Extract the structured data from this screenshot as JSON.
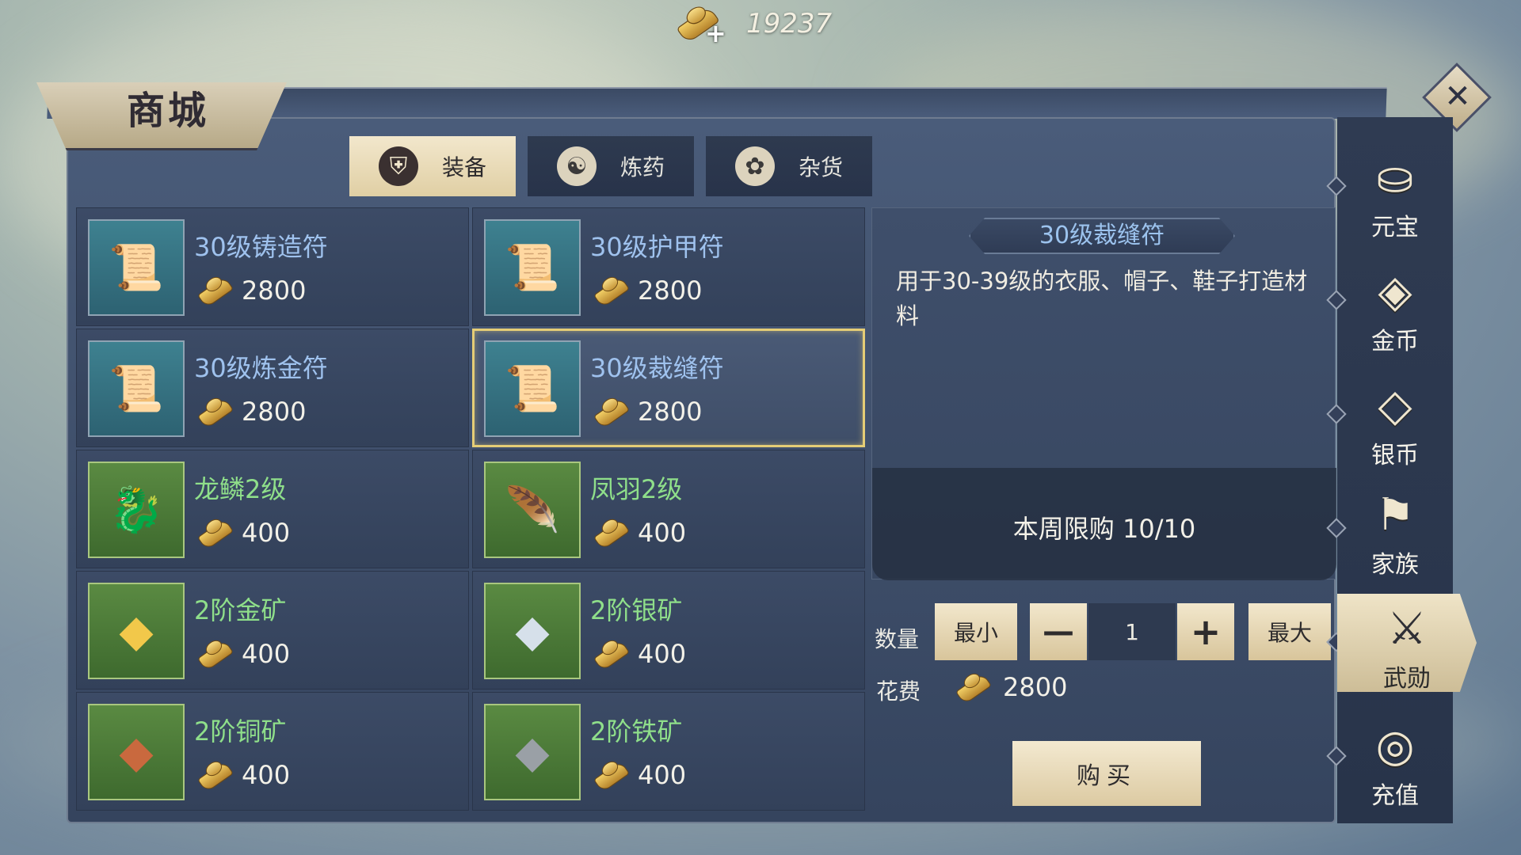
{
  "currency": {
    "amount": "19237",
    "icon": "gold-ingot-plus-icon"
  },
  "title": "商城",
  "tabs": [
    {
      "label": "装备",
      "icon": "armor-icon",
      "active": true
    },
    {
      "label": "炼药",
      "icon": "alchemy-icon",
      "active": false
    },
    {
      "label": "杂货",
      "icon": "goods-bag-icon",
      "active": false
    }
  ],
  "items": [
    {
      "name": "30级铸造符",
      "price": "2800",
      "icon": "forge-scroll-icon",
      "rarity": "blue"
    },
    {
      "name": "30级护甲符",
      "price": "2800",
      "icon": "armor-scroll-icon",
      "rarity": "blue"
    },
    {
      "name": "30级炼金符",
      "price": "2800",
      "icon": "alchemy-scroll-icon",
      "rarity": "blue"
    },
    {
      "name": "30级裁缝符",
      "price": "2800",
      "icon": "tailor-scroll-icon",
      "rarity": "blue",
      "selected": true
    },
    {
      "name": "龙鳞2级",
      "price": "400",
      "icon": "dragon-scale-icon",
      "rarity": "green"
    },
    {
      "name": "凤羽2级",
      "price": "400",
      "icon": "phoenix-feather-icon",
      "rarity": "green"
    },
    {
      "name": "2阶金矿",
      "price": "400",
      "icon": "gold-ore-icon",
      "rarity": "green"
    },
    {
      "name": "2阶银矿",
      "price": "400",
      "icon": "silver-ore-icon",
      "rarity": "green"
    },
    {
      "name": "2阶铜矿",
      "price": "400",
      "icon": "copper-ore-icon",
      "rarity": "green"
    },
    {
      "name": "2阶铁矿",
      "price": "400",
      "icon": "iron-ore-icon",
      "rarity": "green"
    }
  ],
  "detail": {
    "title": "30级裁缝符",
    "description": "用于30-39级的衣服、帽子、鞋子打造材料",
    "weekly_limit": "本周限购 10/10"
  },
  "purchase": {
    "qty_label": "数量",
    "min_label": "最小",
    "minus": "—",
    "qty": "1",
    "plus": "+",
    "max_label": "最大",
    "cost_label": "花费",
    "cost": "2800",
    "buy_label": "购买"
  },
  "side_nav": [
    {
      "label": "元宝",
      "icon": "yuanbao-icon",
      "active": false
    },
    {
      "label": "金币",
      "icon": "gold-coin-icon",
      "active": false
    },
    {
      "label": "银币",
      "icon": "silver-coin-icon",
      "active": false
    },
    {
      "label": "家族",
      "icon": "family-banner-icon",
      "active": false
    },
    {
      "label": "武勋",
      "icon": "crossed-weapons-icon",
      "active": true
    },
    {
      "label": "充值",
      "icon": "coin-stack-icon",
      "active": false
    }
  ],
  "colors": {
    "selected_border": "#e5cd76",
    "blue_name": "#9fc2ee",
    "green_name": "#8fdf8a",
    "panel": "#3d4d68"
  }
}
